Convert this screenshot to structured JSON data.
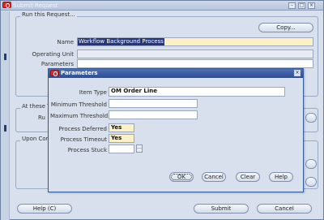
{
  "window": {
    "title": "Submit Request"
  },
  "request": {
    "group_label": "Run this Request...",
    "copy_button": "Copy...",
    "name_label": "Name",
    "name_value": "Workflow Background Process",
    "operating_unit_label": "Operating Unit",
    "parameters_label": "Parameters"
  },
  "schedule": {
    "group_label": "At these Ti",
    "run_label": "Ru"
  },
  "completion": {
    "group_label": "Upon Com"
  },
  "footer": {
    "help_button": "Help (C)",
    "submit_button": "Submit",
    "cancel_button": "Cancel"
  },
  "dialog": {
    "title": "Parameters",
    "item_type_label": "Item Type",
    "item_type_value": "OM Order Line",
    "min_threshold_label": "Minimum Threshold",
    "max_threshold_label": "Maximum Threshold",
    "process_deferred_label": "Process Deferred",
    "process_deferred_value": "Yes",
    "process_timeout_label": "Process Timeout",
    "process_timeout_value": "Yes",
    "process_stuck_label": "Process Stuck",
    "process_stuck_value": "",
    "lov_glyph": "...",
    "ok_button": "OK",
    "cancel_button": "Cancel",
    "clear_button": "Clear",
    "help_button": "Help"
  },
  "colors": {
    "title_bar": "#2e4d92",
    "required_field": "#fbf0c6",
    "selection": "#24367a",
    "oracle_red": "#e1262d"
  }
}
